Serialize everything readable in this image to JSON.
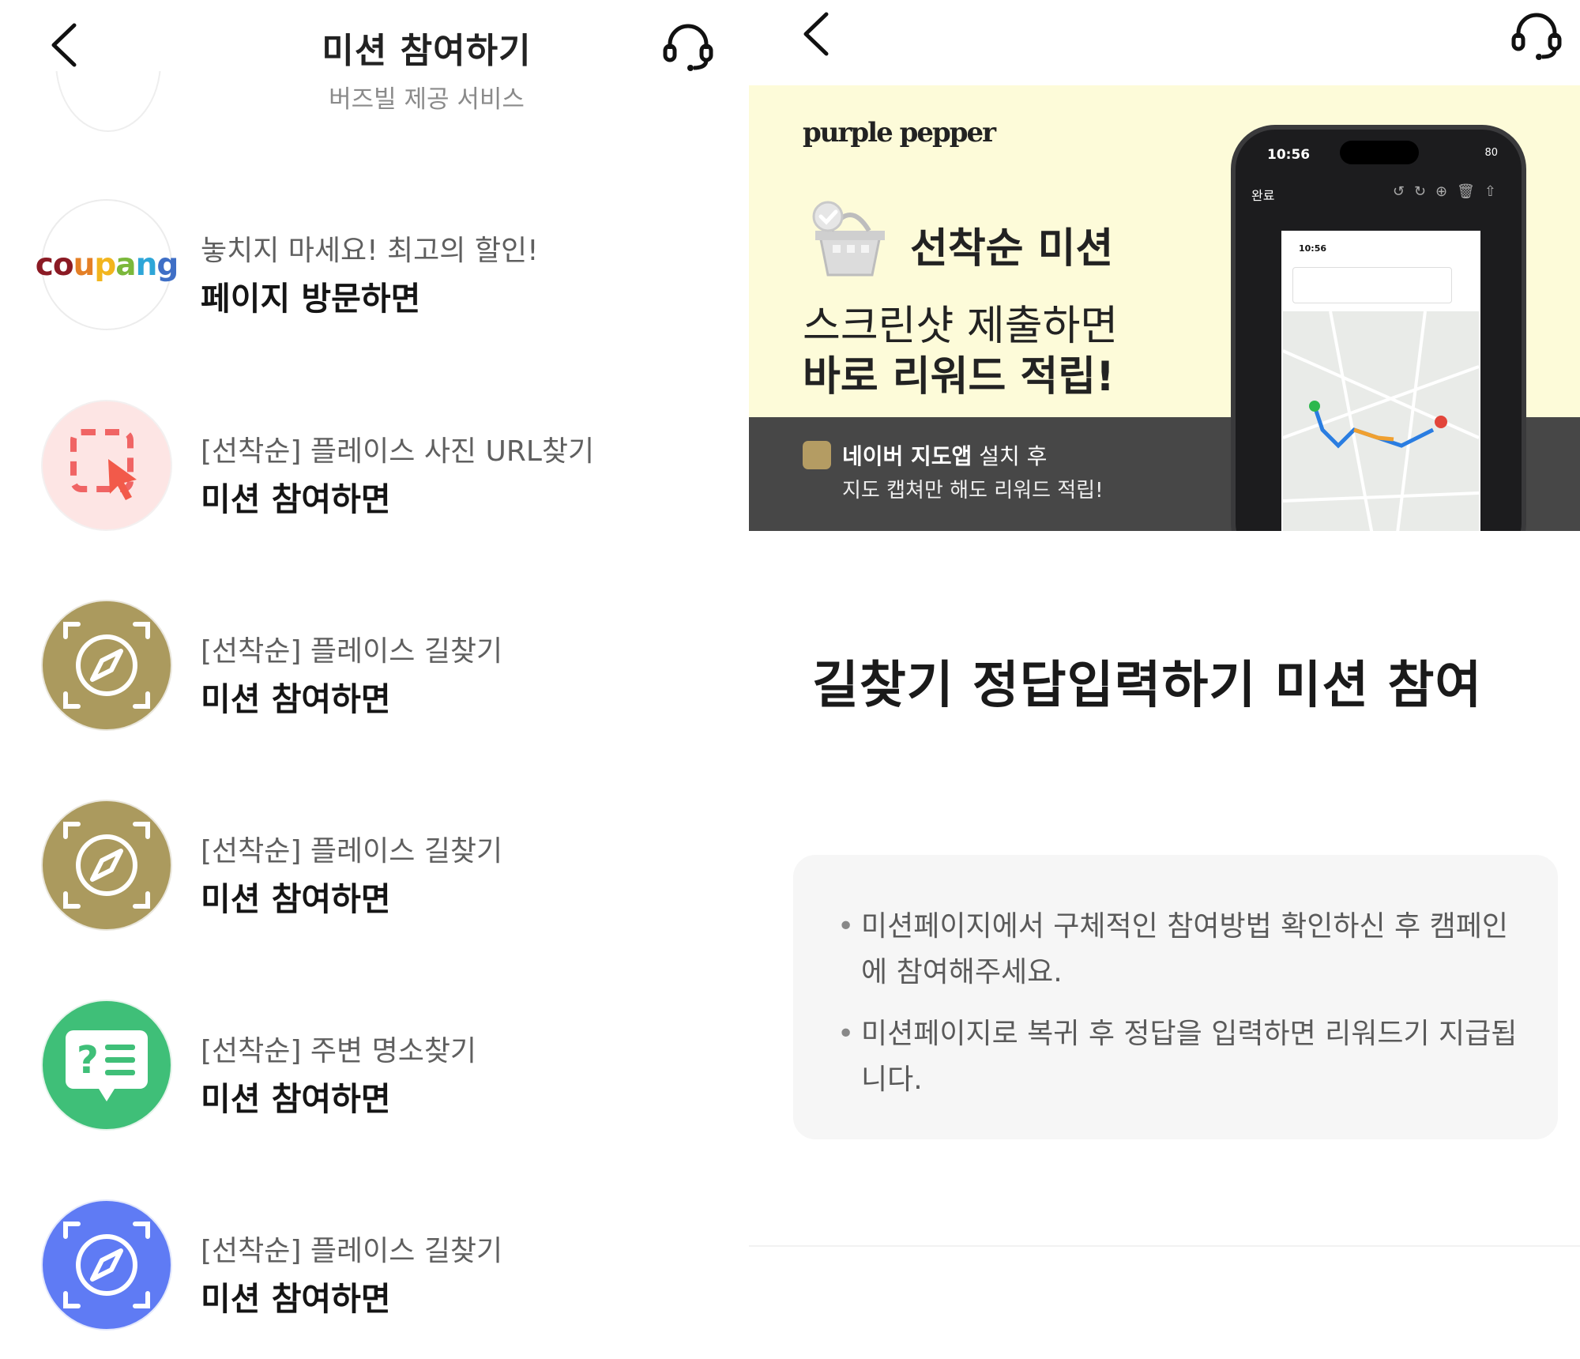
{
  "left": {
    "header": {
      "title": "미션 참여하기",
      "subtitle": "버즈빌 제공 서비스"
    },
    "items": [
      {
        "sub": "놓치지 마세요! 최고의 할인!",
        "main": "페이지 방문하면",
        "icon": "coupang-logo",
        "logo_text": "coupang"
      },
      {
        "sub": "[선착순] 플레이스 사진 URL찾기",
        "main": "미션 참여하면",
        "icon": "select-cursor-icon"
      },
      {
        "sub": "[선착순] 플레이스 길찾기",
        "main": "미션 참여하면",
        "icon": "compass-icon"
      },
      {
        "sub": "[선착순] 플레이스 길찾기",
        "main": "미션 참여하면",
        "icon": "compass-icon"
      },
      {
        "sub": "[선착순] 주변 명소찾기",
        "main": "미션 참여하면",
        "icon": "quiz-bubble-icon"
      },
      {
        "sub": "[선착순] 플레이스 길찾기",
        "main": "미션 참여하면",
        "icon": "compass-icon"
      }
    ]
  },
  "right": {
    "banner": {
      "brand": "purple pepper",
      "headline": "선착순 미션",
      "line1": "스크린샷 제출하면",
      "line2": "바로 리워드 적립!",
      "note_bold": "네이버 지도앱",
      "note_rest": " 설치 후",
      "note2": "지도 캡쳐만 해도 리워드 적립!",
      "phone_time": "10:56",
      "phone_done": "완료",
      "battery": "80"
    },
    "heading": "길찾기 정답입력하기 미션 참여",
    "bullets": [
      "미션페이지에서 구체적인 참여방법 확인하신 후 캠페인에 참여해주세요.",
      "미션페이지로 복귀 후 정답을 입력하면 리워드기 지급됩니다."
    ]
  },
  "colors": {
    "olive": "#ab9a5e",
    "green": "#3fbf78",
    "blue": "#5f7bf4",
    "pink": "#fde5e4",
    "banner_bg": "#fdfbd9",
    "banner_dark": "#474747"
  }
}
